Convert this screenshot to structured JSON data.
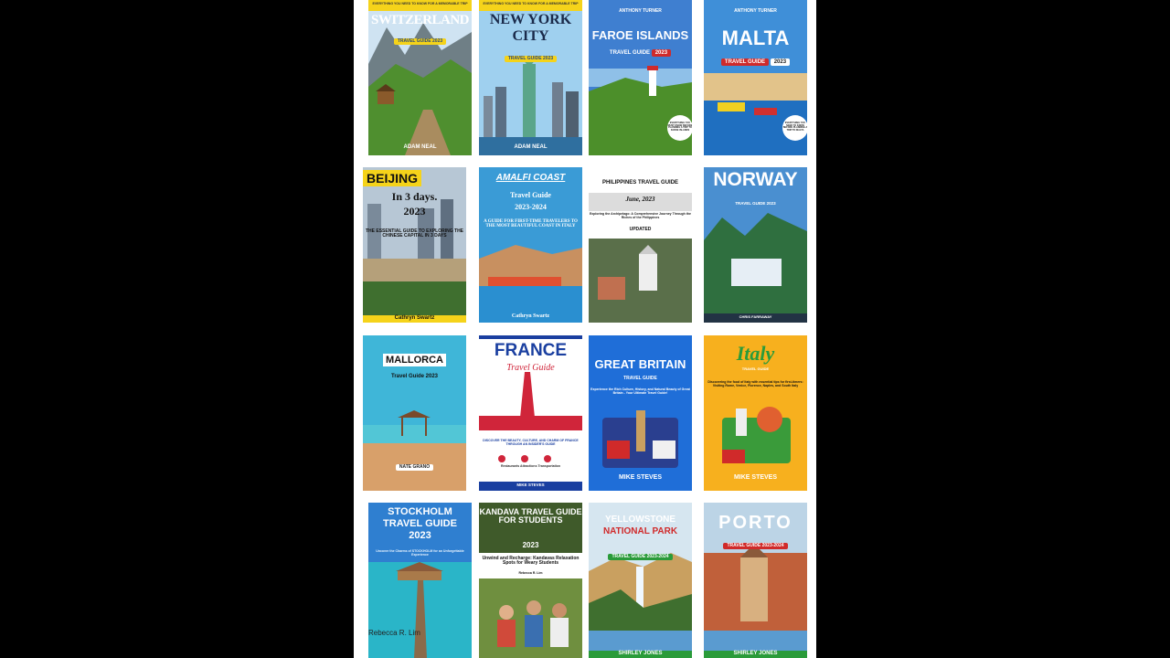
{
  "books": [
    {
      "title": "SWITZERLAND",
      "tagline": "EVERYTHING YOU NEED TO KNOW FOR A MEMORABLE TRIP",
      "subtitle": "TRAVEL GUIDE 2023",
      "author": "ADAM NEAL"
    },
    {
      "title_line1": "NEW YORK",
      "title_line2": "CITY",
      "tagline": "EVERYTHING YOU NEED TO KNOW FOR A MEMORABLE TRIP",
      "subtitle": "TRAVEL GUIDE 2023",
      "author": "ADAM NEAL"
    },
    {
      "author": "ANTHONY TURNER",
      "title": "FAROE ISLANDS",
      "subtitle": "TRAVEL GUIDE",
      "year": "2023",
      "badge": "EVERYTHING YOU MUST KNOW BEFORE PLANNING A TRIP TO FAROE ISLANDS"
    },
    {
      "author": "ANTHONY TURNER",
      "title": "MALTA",
      "subtitle": "TRAVEL GUIDE",
      "year": "2023",
      "badge": "EVERYTHING YOU NEED TO KNOW BEFORE PLANNING A TRIP TO MALTA"
    },
    {
      "title": "BEIJING",
      "line2": "In 3 days.",
      "year": "2023",
      "desc": "THE ESSENTIAL GUIDE TO EXPLORING THE CHINESE CAPITAL IN 3 DAYS",
      "author": "Cathryn Swartz"
    },
    {
      "title": "AMALFI COAST",
      "subtitle": "Travel Guide",
      "years": "2023-2024",
      "desc": "A GUIDE FOR FIRST-TIME TRAVELERS TO THE MOST BEAUTIFUL COAST IN ITALY",
      "author": "Cathryn Swartz"
    },
    {
      "title": "PHILIPPINES TRAVEL GUIDE",
      "date": "June, 2023",
      "desc": "Exploring the Archipelago: A Comprehensive Journey Through the Riches of the Philippines",
      "tag": "UPDATED"
    },
    {
      "title": "NORWAY",
      "subtitle": "TRAVEL GUIDE 2023",
      "author": "CHRIS FARRAWAY"
    },
    {
      "title": "MALLORCA",
      "subtitle": "Travel Guide 2023",
      "author": "NATE GRANO"
    },
    {
      "title": "FRANCE",
      "subtitle": "Travel Guide",
      "desc": "DISCOVER THE BEAUTY, CULTURE, AND CHARM OF FRANCE THROUGH AN INSIDER'S GUIDE",
      "icons": [
        "Restaurants",
        "Attractions",
        "Transportation"
      ],
      "author": "MIKE STEVES"
    },
    {
      "title": "GREAT BRITAIN",
      "subtitle": "TRAVEL GUIDE",
      "desc": "Experience the Rich Culture, History, and Natural Beauty of Great Britain - Your Ultimate Travel Guide!",
      "author": "MIKE STEVES"
    },
    {
      "title": "Italy",
      "subtitle": "TRAVEL GUIDE",
      "desc": "Discovering the food of Italy with essential tips for first-timers: Visiting Rome, Venice, Florence, Naples, and South Italy",
      "author": "MIKE STEVES"
    },
    {
      "title_line1": "STOCKHOLM",
      "title_line2": "TRAVEL GUIDE",
      "year": "2023",
      "desc": "Uncover the Charms of STOCKHOLM for an Unforgettable Experience",
      "author": "Rebecca R. Lim"
    },
    {
      "title": "KANDAVA TRAVEL GUIDE FOR STUDENTS",
      "year": "2023",
      "desc": "Unwind and Recharge: Kandavas Relaxation Spots for Weary Students",
      "author": "Rebecca R. Lim"
    },
    {
      "title_line1": "YELLOWSTONE",
      "title_line2": "NATIONAL PARK",
      "subtitle": "TRAVEL GUIDE 2023-2024",
      "author": "SHIRLEY JONES"
    },
    {
      "title": "PORTO",
      "subtitle": "TRAVEL GUIDE 2023-2024",
      "author": "SHIRLEY JONES"
    }
  ]
}
